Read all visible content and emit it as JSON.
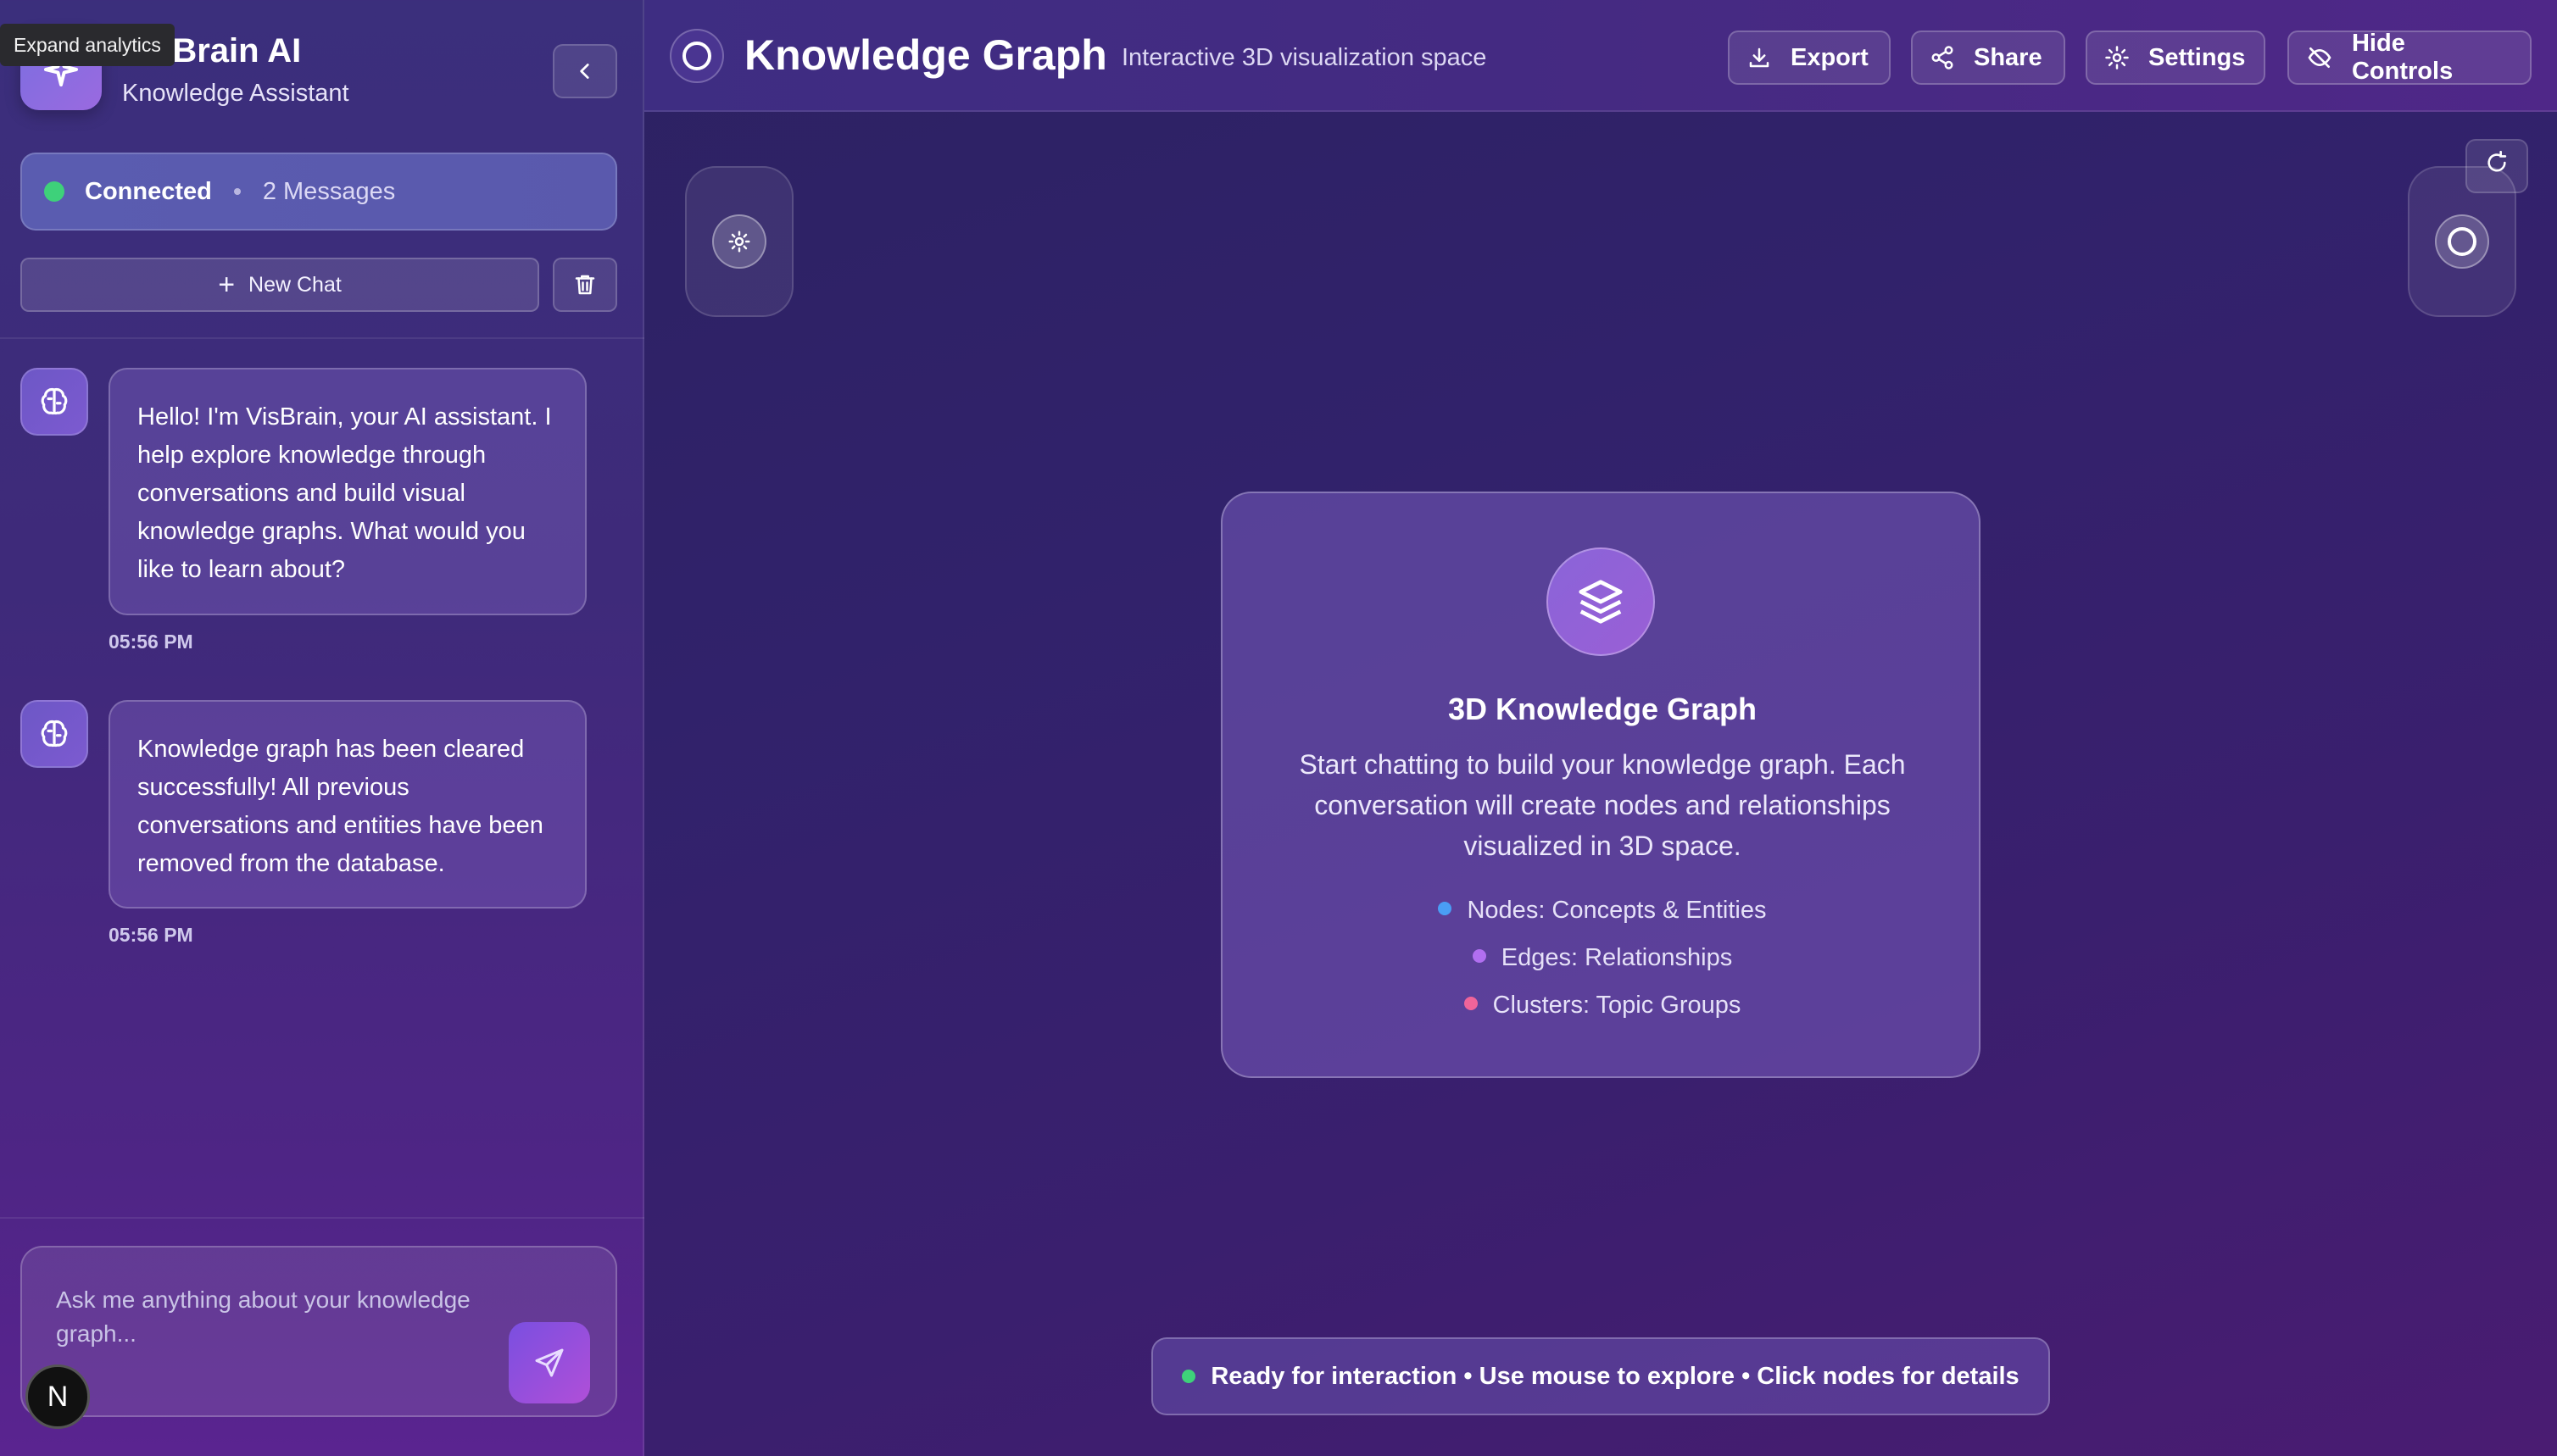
{
  "tooltip": "Expand analytics",
  "sidebar": {
    "app_title": "VisBrain AI",
    "app_subtitle": "Knowledge Assistant",
    "status": {
      "connected_label": "Connected",
      "messages_label": "2 Messages",
      "dot_color": "#3ed17a"
    },
    "new_chat_label": "New Chat",
    "messages": [
      {
        "text": "Hello! I'm VisBrain, your AI assistant. I help explore knowledge through conversations and build visual knowledge graphs. What would you like to learn about?",
        "time": "05:56 PM"
      },
      {
        "text": "Knowledge graph has been cleared successfully! All previous conversations and entities have been removed from the database.",
        "time": "05:56 PM"
      }
    ],
    "input_placeholder": "Ask me anything about your knowledge graph...",
    "user_badge": "N"
  },
  "header": {
    "title": "Knowledge Graph",
    "subtitle": "Interactive 3D visualization space",
    "buttons": {
      "export": "Export",
      "share": "Share",
      "settings": "Settings",
      "hide_controls": "Hide Controls"
    }
  },
  "card": {
    "title": "3D Knowledge Graph",
    "description": "Start chatting to build your knowledge graph. Each conversation will create nodes and relationships visualized in 3D space.",
    "legend": [
      {
        "label": "Nodes: Concepts & Entities",
        "color": "#4a9ef5"
      },
      {
        "label": "Edges: Relationships",
        "color": "#b16ff0"
      },
      {
        "label": "Clusters: Topic Groups",
        "color": "#f0649a"
      }
    ]
  },
  "status_bar": {
    "text": "Ready for interaction • Use mouse to explore • Click nodes for details",
    "dot_color": "#3ed17a"
  },
  "icons": [
    "sparkle-icon",
    "chevron-left-icon",
    "plus-icon",
    "trash-icon",
    "brain-icon",
    "send-icon",
    "ring-icon",
    "download-icon",
    "share-icon",
    "gear-icon",
    "eye-off-icon",
    "refresh-icon",
    "layers-icon"
  ]
}
